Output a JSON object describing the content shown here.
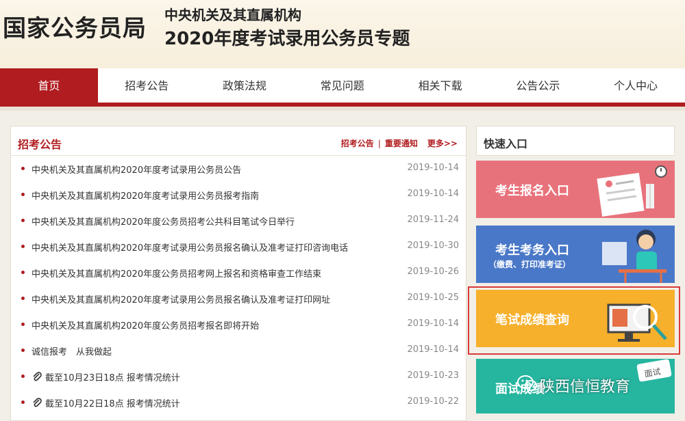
{
  "header": {
    "site_title": "国家公务员局",
    "sub_title_1": "中央机关及其直属机构",
    "sub_title_2": "2020年度考试录用公务员专题"
  },
  "nav": {
    "items": [
      "首页",
      "招考公告",
      "政策法规",
      "常见问题",
      "相关下载",
      "公告公示",
      "个人中心"
    ],
    "active": "首页"
  },
  "news_panel": {
    "title": "招考公告",
    "links": [
      "招考公告",
      "重要通知"
    ],
    "more": "更多>>",
    "items": [
      {
        "text": "中央机关及其直属机构2020年度考试录用公务员公告",
        "date": "2019-10-14"
      },
      {
        "text": "中央机关及其直属机构2020年度考试录用公务员报考指南",
        "date": "2019-10-14"
      },
      {
        "text": "中央机关及其直属机构2020年度公务员招考公共科目笔试今日举行",
        "date": "2019-11-24"
      },
      {
        "text": "中央机关及其直属机构2020年度考试录用公务员报名确认及准考证打印咨询电话",
        "date": "2019-10-30"
      },
      {
        "text": "中央机关及其直属机构2020年度公务员招考网上报名和资格审查工作结束",
        "date": "2019-10-26"
      },
      {
        "text": "中央机关及其直属机构2020年度考试录用公务员报名确认及准考证打印网址",
        "date": "2019-10-25"
      },
      {
        "text": "中央机关及其直属机构2020年度公务员招考报名即将开始",
        "date": "2019-10-14"
      },
      {
        "text": "诚信报考　从我做起",
        "date": "2019-10-14"
      },
      {
        "text": "截至10月23日18点 报考情况统计",
        "date": "2019-10-23"
      },
      {
        "text": "截至10月22日18点 报考情况统计",
        "date": "2019-10-22"
      }
    ]
  },
  "quick_panel": {
    "title": "快速入口",
    "tiles": [
      {
        "label": "考生报名入口"
      },
      {
        "label": "考生考务入口",
        "sub": "（缴费、打印准考证）"
      },
      {
        "label": "笔试成绩查询"
      },
      {
        "label": "面试成绩",
        "badge": "面试"
      }
    ]
  },
  "watermark": "陕西信恒教育",
  "colors": {
    "brand_red": "#b01c1f",
    "tile_pink": "#e8727b",
    "tile_blue": "#4a78c8",
    "tile_orange": "#f6b02c",
    "tile_green": "#26b59f"
  }
}
